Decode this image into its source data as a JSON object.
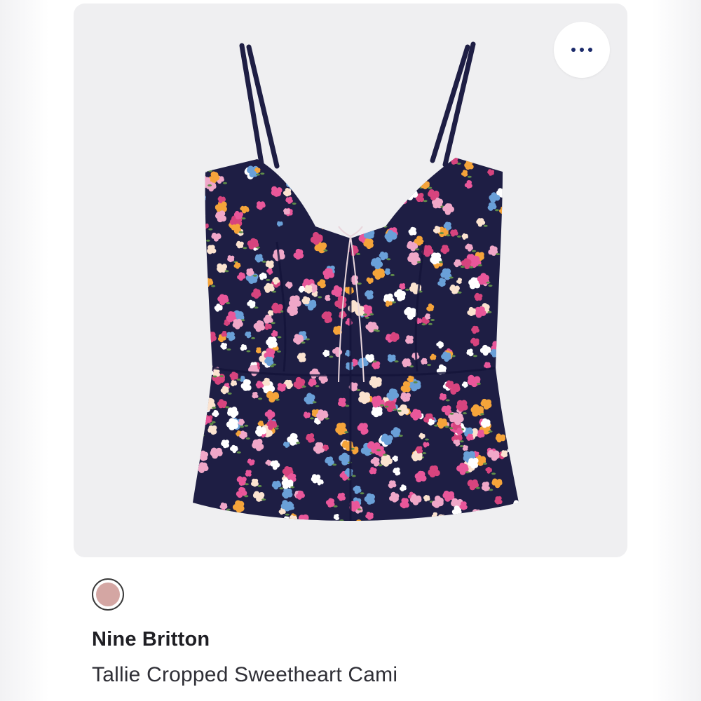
{
  "product": {
    "brand": "Nine Britton",
    "name": "Tallie Cropped Sweetheart Cami",
    "selected_color": "#d4a6a3",
    "image_icon": "floral-cami-image"
  },
  "more_button": {
    "icon": "ellipsis-icon",
    "dot_color": "#1b2a6b"
  },
  "colors": {
    "card_background": "#efeff1",
    "garment_base": "#1e1e44"
  }
}
